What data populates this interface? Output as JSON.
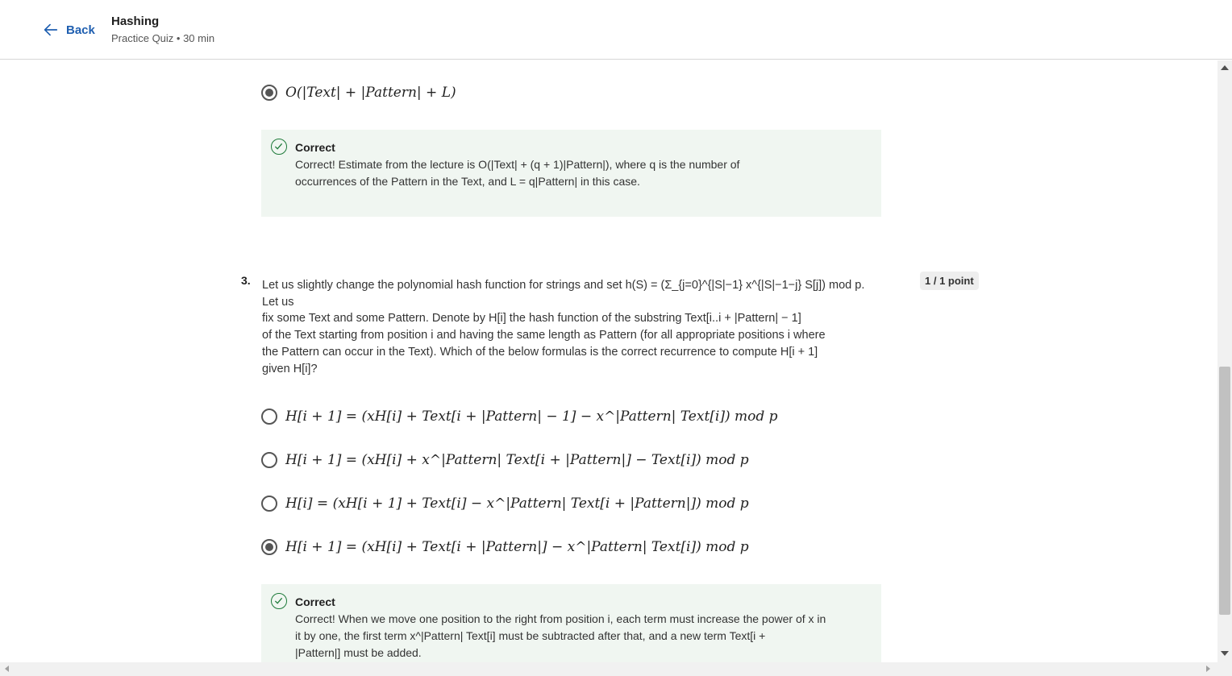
{
  "header": {
    "back_label": "Back",
    "title": "Hashing",
    "subtitle": "Practice Quiz • 30 min"
  },
  "q2": {
    "selected_option": "O(|Text| + |Pattern| + L)",
    "feedback_title": "Correct",
    "feedback_text_1": "Correct! Estimate from the lecture is O(|Text| + (q + 1)|Pattern|), where q is the number of",
    "feedback_text_2": "occurrences of the Pattern in the Text, and L = q|Pattern| in this case."
  },
  "q3": {
    "number": "3.",
    "points": "1 / 1 point",
    "text_line1": "Let us slightly change the polynomial hash function for strings and set h(S) = (Σ_{j=0}^{|S|−1} x^{|S|−1−j} S[j]) mod p. Let us",
    "text_line2": "fix some Text and some Pattern. Denote by H[i] the hash function of the substring Text[i..i + |Pattern| − 1]",
    "text_line3": "of the Text starting from position i and having the same length as Pattern (for all appropriate positions i where",
    "text_line4": "the Pattern can occur in the Text). Which of the below formulas is the correct recurrence to compute H[i + 1]",
    "text_line5": "given H[i]?",
    "options": [
      "H[i + 1] = (xH[i] + Text[i + |Pattern| − 1] − x^|Pattern| Text[i]) mod p",
      "H[i + 1] = (xH[i] + x^|Pattern| Text[i + |Pattern|] − Text[i]) mod p",
      "H[i] = (xH[i + 1] + Text[i] − x^|Pattern| Text[i + |Pattern|]) mod p",
      "H[i + 1] = (xH[i] + Text[i + |Pattern|] − x^|Pattern| Text[i]) mod p"
    ],
    "selected_index": 3,
    "feedback_title": "Correct",
    "feedback_text_1": "Correct! When we move one position to the right from position i, each term must increase the power of x in",
    "feedback_text_2": "it by one, the first term x^|Pattern| Text[i] must be subtracted after that, and a new term Text[i +",
    "feedback_text_3": "|Pattern|] must be added."
  }
}
